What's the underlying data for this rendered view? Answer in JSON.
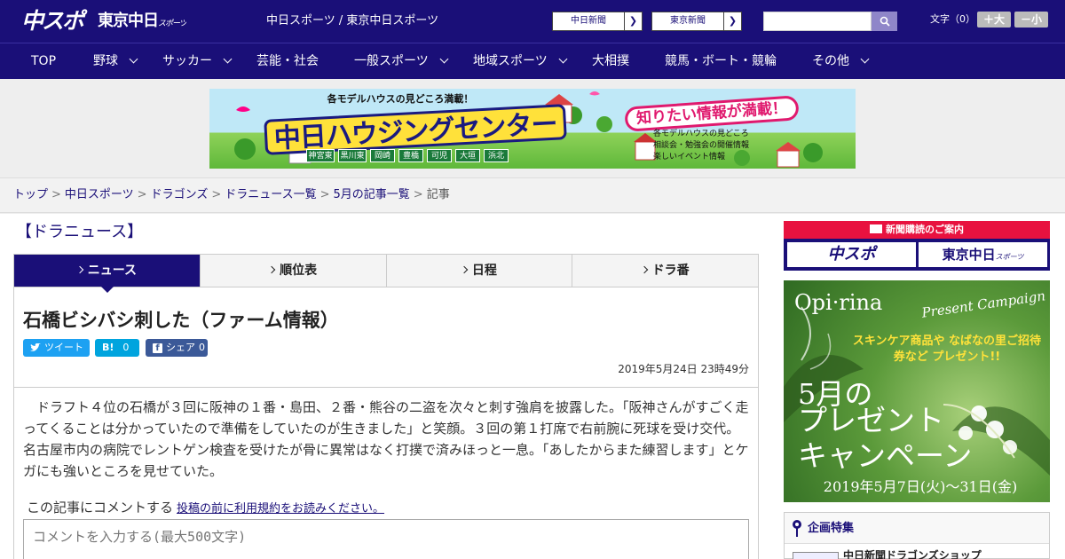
{
  "header": {
    "logo_main": "中スポ",
    "logo_tokyo": "東京中日",
    "logo_tokyo_sub": "スポーツ",
    "site_link_1": "中日スポーツ",
    "site_link_sep": " / ",
    "site_link_2": "東京中日スポーツ",
    "paper_btn_1": "中日新聞",
    "paper_btn_2": "東京新聞",
    "search_placeholder": "",
    "font_size_label": "文字（0）",
    "font_plus": "＋大",
    "font_minus": "－小"
  },
  "nav": [
    {
      "label": "TOP"
    },
    {
      "label": "野球"
    },
    {
      "label": "サッカー"
    },
    {
      "label": "芸能・社会"
    },
    {
      "label": "一般スポーツ"
    },
    {
      "label": "地域スポーツ"
    },
    {
      "label": "大相撲"
    },
    {
      "label": "競馬・ボート・競輪"
    },
    {
      "label": "その他"
    }
  ],
  "ad": {
    "top_line": "各モデルハウスの見どころ満載！",
    "title": "中日ハウジングセンター",
    "badge": "知りたい情報が満載！",
    "bullets": [
      "各モデルハウスの見どころ",
      "相談会・勉強会の開催情報",
      "楽しいイベント情報"
    ],
    "cities": [
      "神宮東",
      "黒川東",
      "岡崎",
      "豊橋",
      "可児",
      "大垣",
      "浜北"
    ]
  },
  "breadcrumb": {
    "items": [
      "トップ",
      "中日スポーツ",
      "ドラゴンズ",
      "ドラニュース一覧",
      "5月の記事一覧"
    ],
    "current": "記事"
  },
  "section_title": "【ドラニュース】",
  "tabs": [
    "ニュース",
    "順位表",
    "日程",
    "ドラ番"
  ],
  "article": {
    "title": "石橋ビシバシ刺した（ファーム情報）",
    "tweet_label": "ツイート",
    "hatena_label": "B!",
    "hatena_count": "0",
    "share_label": "シェア",
    "share_count": "0",
    "date": "2019年5月24日 23時49分",
    "body": "ドラフト４位の石橋が３回に阪神の１番・島田、２番・熊谷の二盗を次々と刺す強肩を披露した。「阪神さんがすごく走ってくることは分かっていたので準備をしていたのが生きました」と笑顔。３回の第１打席で右前腕に死球を受け交代。名古屋市内の病院でレントゲン検査を受けたが骨に異常はなく打撲で済みほっと一息。「あしたからまた練習します」とケガにも強いところを見せていた。",
    "comment_label": "この記事にコメントする",
    "comment_link": "投稿の前に利用規約をお読みください。",
    "comment_placeholder": "コメントを入力する(最大500文字)"
  },
  "sidebar": {
    "subscribe_head": "新聞購読のご案内",
    "subscribe_btn_1": "中スポ",
    "subscribe_btn_2": "東京中日",
    "subscribe_btn_2_sub": "スポーツ",
    "promo_brand": "Opi·rina",
    "promo_campaign": "Present Campaign",
    "promo_sub": "スキンケア商品や なばなの里ご招待券など プレゼント!!",
    "promo_month": "5月の",
    "promo_word_1": "プレゼント",
    "promo_word_2": "キャンペーン",
    "promo_date": "2019年5月7日(火)〜31日(金)",
    "feature_head": "企画特集",
    "feature_item": "中日新聞ドラゴンズショップ"
  },
  "colors": {
    "brand": "#1a0f78",
    "accent_red": "#e8123f",
    "twitter": "#1da1f2",
    "hatena": "#00a4de",
    "facebook": "#3b5998"
  }
}
